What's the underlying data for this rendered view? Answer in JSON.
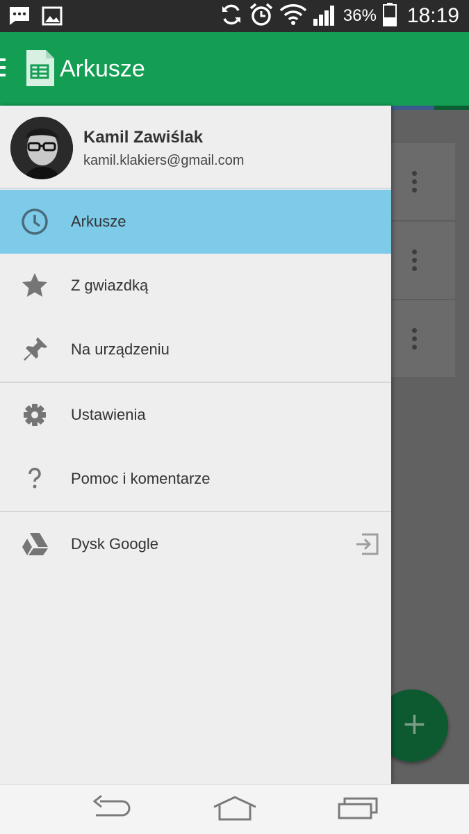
{
  "status_bar": {
    "left_icons": [
      "message-notification-icon",
      "image-notification-icon"
    ],
    "right_icons": [
      "sync-icon",
      "alarm-icon",
      "wifi-icon",
      "signal-icon",
      "battery-icon"
    ],
    "battery": "36%",
    "time": "18:19"
  },
  "app_bar": {
    "title": "Arkusze",
    "color": "#149e54"
  },
  "drawer": {
    "profile": {
      "name": "Kamil Zawiślak",
      "email": "kamil.klakiers@gmail.com"
    },
    "items": [
      {
        "label": "Arkusze",
        "icon": "clock-icon",
        "active": true
      },
      {
        "label": "Z gwiazdką",
        "icon": "star-icon",
        "active": false
      },
      {
        "label": "Na urządzeniu",
        "icon": "pin-icon",
        "active": false
      },
      {
        "label": "Ustawienia",
        "icon": "gear-icon",
        "active": false
      },
      {
        "label": "Pomoc i komentarze",
        "icon": "help-icon",
        "active": false
      },
      {
        "label": "Dysk Google",
        "icon": "drive-icon",
        "active": false,
        "trailing_icon": "open-external-icon"
      }
    ],
    "active_color": "#7ecbe9"
  },
  "fab": {
    "symbol": "+"
  },
  "nav_bar": {
    "buttons": [
      "back-icon",
      "home-icon",
      "recents-icon"
    ]
  }
}
